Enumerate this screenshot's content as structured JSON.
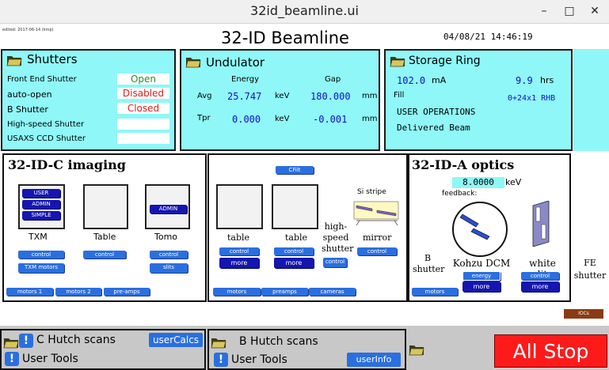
{
  "window": {
    "title": "32id_beamline.ui",
    "minimize": "–",
    "maximize": "□",
    "close": "✕"
  },
  "header": {
    "edited": "edited: 2017-06-14 (kmp)",
    "title": "32-ID Beamline",
    "datetime": "04/08/21 14:46:19"
  },
  "shutters": {
    "title": "Shutters",
    "rows": [
      {
        "label": "Front End Shutter",
        "value": "Open"
      },
      {
        "label": "auto-open",
        "value": "Disabled"
      },
      {
        "label": "B Shutter",
        "value": "Closed"
      },
      {
        "label": "High-speed Shutter",
        "value": ""
      },
      {
        "label": "USAXS CCD Shutter",
        "value": ""
      }
    ]
  },
  "undulator": {
    "title": "Undulator",
    "col_energy": "Energy",
    "col_gap": "Gap",
    "avg_label": "Avg",
    "avg_energy": "25.747",
    "avg_energy_unit": "keV",
    "avg_gap": "180.000",
    "avg_gap_unit": "mm",
    "tpr_label": "Tpr",
    "tpr_energy": "0.000",
    "tpr_energy_unit": "keV",
    "tpr_gap": "-0.001",
    "tpr_gap_unit": "mm"
  },
  "storage_ring": {
    "title": "Storage Ring",
    "current": "102.0",
    "current_unit": "mA",
    "lifetime": "9.9",
    "lifetime_unit": "hrs",
    "fill_label": "Fill",
    "fill_value": "0+24x1 RHB",
    "status1": "USER OPERATIONS",
    "status2": "Delivered Beam"
  },
  "c_imaging": {
    "title": "32-ID-C imaging",
    "txm_buttons": [
      "USER",
      "ADMIN",
      "SIMPLE"
    ],
    "txm_label": "TXM",
    "table_label": "Table",
    "tomo_label": "Tomo",
    "tomo_admin": "ADMIN",
    "control": "control",
    "txm_motors": "TXM motors",
    "slits": "slits",
    "motors1": "motors 1",
    "motors2": "motors 2",
    "preamps": "pre-amps"
  },
  "b_middle": {
    "cfil": "CFilt",
    "table": "table",
    "si_stripe": "Si stripe",
    "hs_line1": "high-",
    "hs_line2": "speed",
    "hs_line3": "shutter",
    "mirror": "mirror",
    "control": "control",
    "more": "more",
    "motors": "motors",
    "preamps": "preamps",
    "cameras": "cameras"
  },
  "a_optics": {
    "title": "32-ID-A optics",
    "energy": "8.0000",
    "energy_unit": "keV",
    "feedback": "feedback:",
    "b_shutter_1": "B",
    "b_shutter_2": "shutter",
    "dcm": "Kohzu DCM",
    "white_slits": "white slits",
    "energy_btn": "energy",
    "control": "control",
    "more": "more",
    "motors": "motors"
  },
  "fe_shutter": {
    "line1": "FE",
    "line2": "shutter",
    "ioc": "IOCs"
  },
  "bottom": {
    "c_hutch": "C Hutch scans",
    "user_calcs": "userCalcs",
    "user_tools": "User Tools",
    "b_hutch": "B Hutch scans",
    "user_info": "userInfo",
    "user_tools2": "User Tools",
    "all_stop": "All Stop"
  },
  "colors": {
    "panel_bg": "#8ff7f7",
    "open": "#2a8a2a",
    "alarm": "#e02020",
    "readback": "#1010c8",
    "all_stop": "#ff1a1a"
  }
}
